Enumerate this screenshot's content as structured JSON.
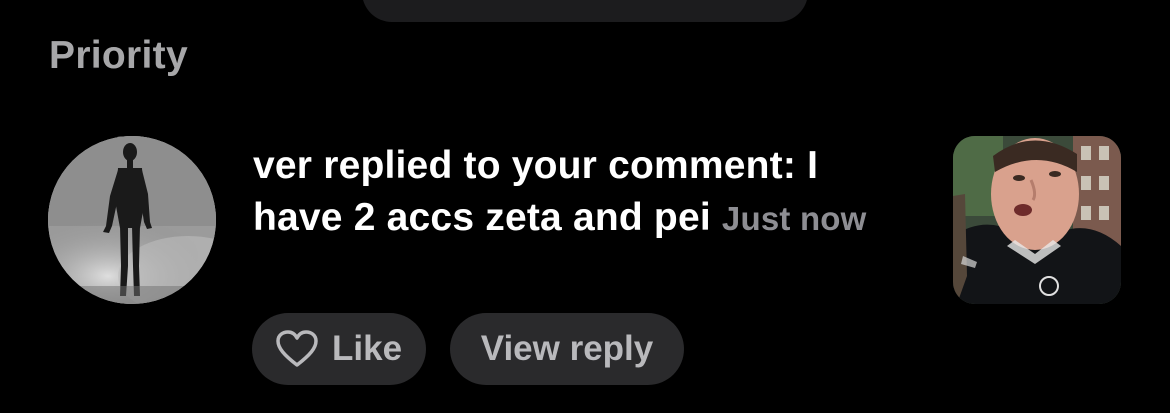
{
  "section": {
    "title": "Priority"
  },
  "notification": {
    "message": "ver replied to your comment: I have 2 accs zeta and pei",
    "timestamp": "Just now",
    "actions": {
      "like_label": "Like",
      "view_reply_label": "View reply"
    },
    "icons": {
      "like": "heart-outline-icon"
    }
  },
  "colors": {
    "background": "#000000",
    "section_title": "#a7a7a9",
    "button_bg": "#2a2a2c",
    "button_text": "#b9b9bc",
    "timestamp": "#8e8e93"
  }
}
